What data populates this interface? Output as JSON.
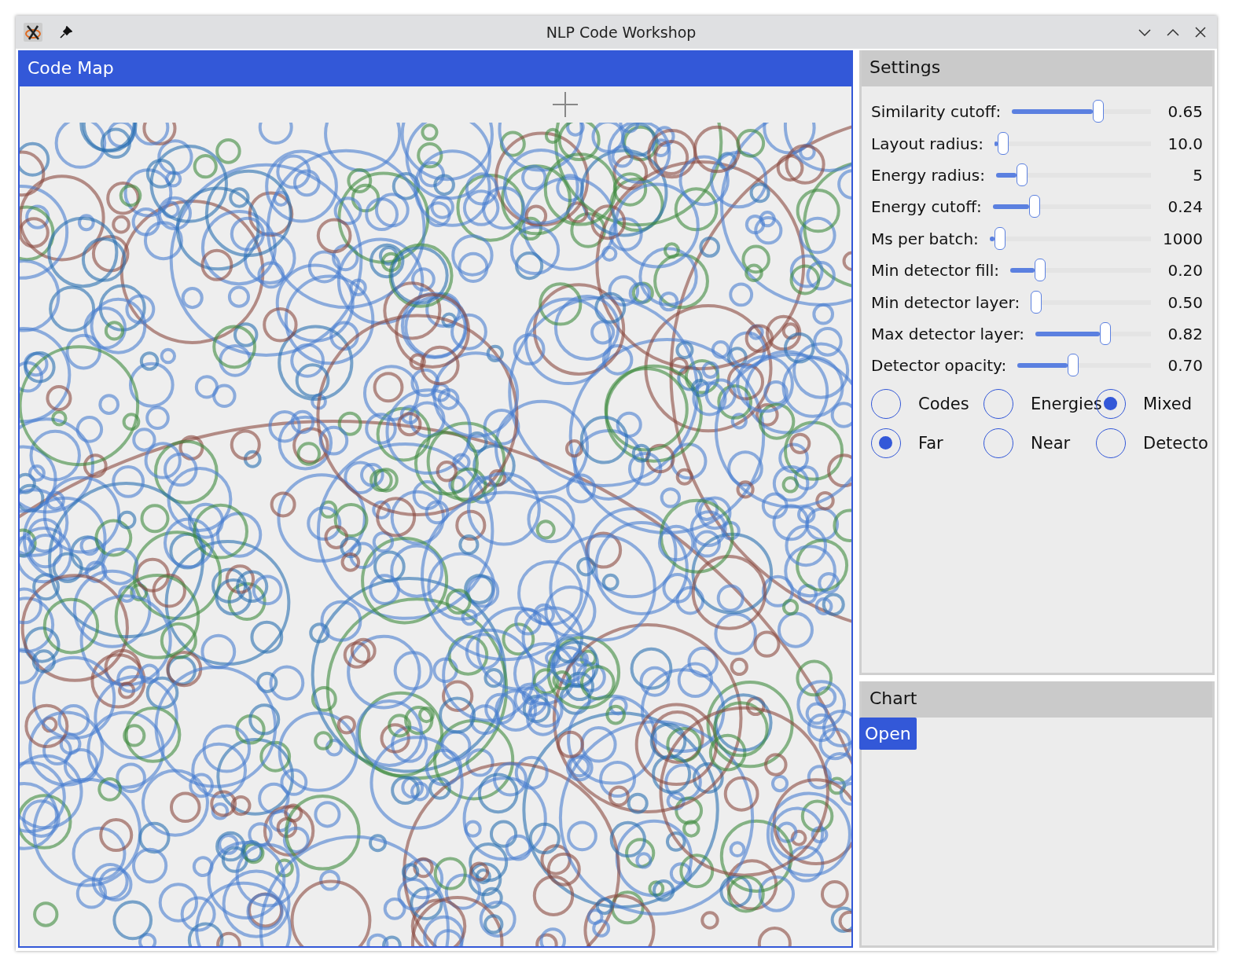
{
  "window": {
    "title": "NLP Code Workshop"
  },
  "code_map": {
    "title": "Code Map"
  },
  "settings": {
    "title": "Settings",
    "sliders": [
      {
        "label": "Similarity cutoff:",
        "level": 0.63,
        "reading": "0.65"
      },
      {
        "label": "Layout radius:",
        "level": 0.02,
        "reading": "10.0"
      },
      {
        "label": "Energy radius:",
        "level": 0.14,
        "reading": "5"
      },
      {
        "label": "Energy cutoff:",
        "level": 0.25,
        "reading": "0.24"
      },
      {
        "label": "Ms per batch:",
        "level": 0.03,
        "reading": "1000"
      },
      {
        "label": "Min detector fill:",
        "level": 0.19,
        "reading": "0.20"
      },
      {
        "label": "Min detector layer:",
        "level": 0.0,
        "reading": "0.50"
      },
      {
        "label": "Max detector layer:",
        "level": 0.62,
        "reading": "0.82"
      },
      {
        "label": "Detector opacity:",
        "level": 0.41,
        "reading": "0.70"
      }
    ],
    "radio_groups": [
      [
        {
          "label": "Codes",
          "selected": false
        },
        {
          "label": "Energies",
          "selected": false
        },
        {
          "label": "Mixed",
          "selected": true
        }
      ],
      [
        {
          "label": "Far",
          "selected": true
        },
        {
          "label": "Near",
          "selected": false
        },
        {
          "label": "Detecto",
          "selected": false
        }
      ]
    ]
  },
  "chart": {
    "title": "Chart",
    "button": "Open"
  }
}
